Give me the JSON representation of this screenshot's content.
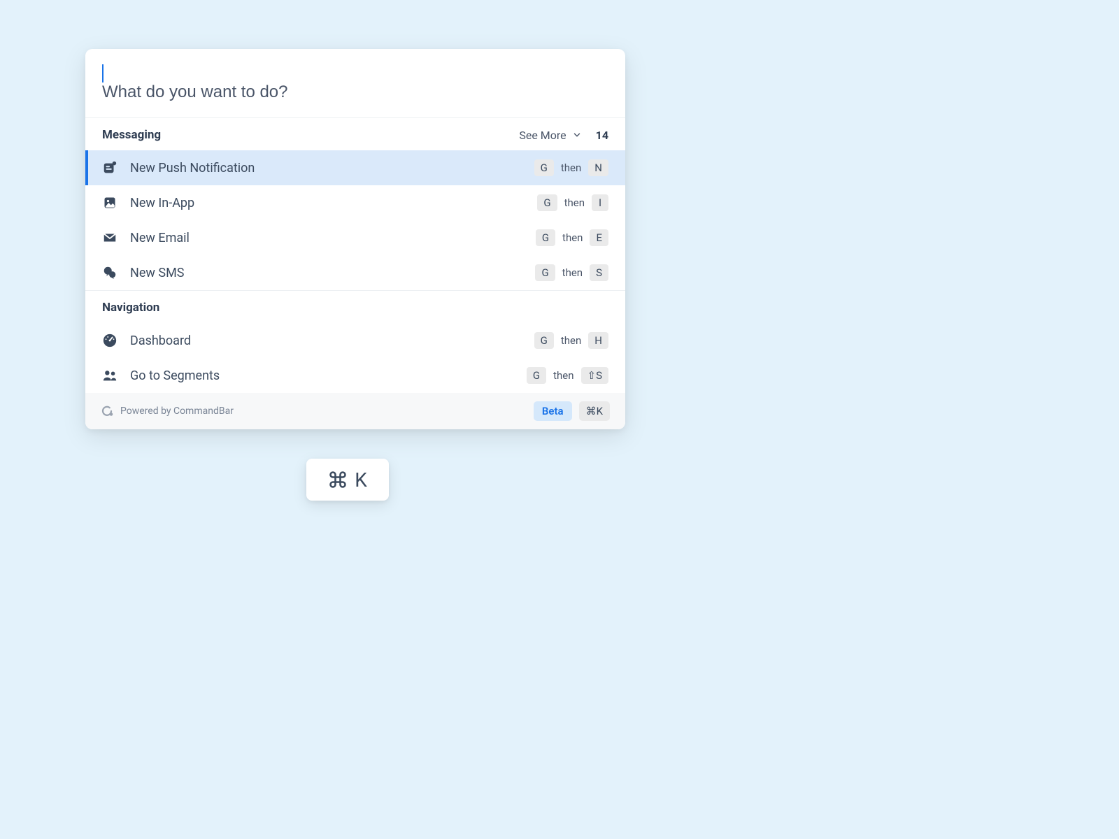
{
  "search": {
    "placeholder": "What do you want to do?",
    "value": ""
  },
  "sections": [
    {
      "id": "messaging",
      "title": "Messaging",
      "see_more": {
        "label": "See More",
        "count": "14"
      },
      "items": [
        {
          "id": "new-push",
          "icon": "push-icon",
          "label": "New Push Notification",
          "shortcut": {
            "k1": "G",
            "mid": "then",
            "k2": "N"
          },
          "selected": true
        },
        {
          "id": "new-inapp",
          "icon": "inapp-icon",
          "label": "New In-App",
          "shortcut": {
            "k1": "G",
            "mid": "then",
            "k2": "I"
          }
        },
        {
          "id": "new-email",
          "icon": "email-icon",
          "label": "New Email",
          "shortcut": {
            "k1": "G",
            "mid": "then",
            "k2": "E"
          }
        },
        {
          "id": "new-sms",
          "icon": "sms-icon",
          "label": "New SMS",
          "shortcut": {
            "k1": "G",
            "mid": "then",
            "k2": "S"
          }
        }
      ]
    },
    {
      "id": "navigation",
      "title": "Navigation",
      "items": [
        {
          "id": "dashboard",
          "icon": "gauge-icon",
          "label": "Dashboard",
          "shortcut": {
            "k1": "G",
            "mid": "then",
            "k2": "H"
          }
        },
        {
          "id": "segments",
          "icon": "people-icon",
          "label": "Go to Segments",
          "shortcut": {
            "k1": "G",
            "mid": "then",
            "k2": "⇧S"
          }
        }
      ]
    }
  ],
  "footer": {
    "powered_by": "Powered by CommandBar",
    "beta": "Beta",
    "shortcut": "⌘K"
  },
  "floating": {
    "shortcut_key": "K"
  }
}
